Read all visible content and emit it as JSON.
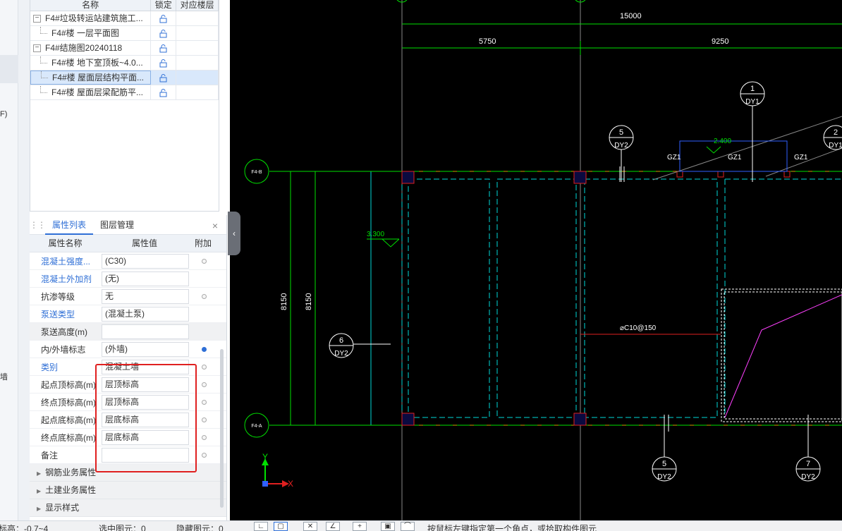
{
  "left_strip": {
    "frag1": "F)",
    "frag2": "墙"
  },
  "layer_tree": {
    "columns": {
      "name": "名称",
      "lock": "锁定",
      "floor": "对应楼层"
    },
    "rows": [
      {
        "label": "F4#垃圾转运站建筑施工...",
        "level": 0,
        "toggle": "−"
      },
      {
        "label": "F4#楼 一层平面图",
        "level": 1
      },
      {
        "label": "F4#结施图20240118",
        "level": 0,
        "toggle": "−"
      },
      {
        "label": "F4#楼 地下室顶板~4.0...",
        "level": 1
      },
      {
        "label": "F4#楼 屋面层结构平面...",
        "level": 1,
        "selected": true
      },
      {
        "label": "F4#楼 屋面层梁配筋平...",
        "level": 1
      }
    ]
  },
  "props": {
    "tabs": [
      "属性列表",
      "图层管理"
    ],
    "close": "×",
    "headers": {
      "name": "属性名称",
      "value": "属性值",
      "add": "附加"
    },
    "rows": [
      {
        "name": "混凝土强度...",
        "value": "(C30)",
        "blue": true,
        "dot": "off"
      },
      {
        "name": "混凝土外加剂",
        "value": "(无)",
        "blue": true,
        "dot": "none"
      },
      {
        "name": "抗渗等级",
        "value": "无",
        "blue": false,
        "dot": "off"
      },
      {
        "name": "泵送类型",
        "value": "(混凝土泵)",
        "blue": true,
        "dot": "none"
      },
      {
        "name": "泵送高度(m)",
        "value": "",
        "blue": false,
        "dot": "none",
        "gray": true
      },
      {
        "name": "内/外墙标志",
        "value": "(外墙)",
        "blue": false,
        "dot": "on"
      },
      {
        "name": "类别",
        "value": "混凝土墙",
        "blue": true,
        "dot": "off"
      },
      {
        "name": "起点顶标高(m)",
        "value": "层顶标高",
        "blue": false,
        "dot": "off"
      },
      {
        "name": "终点顶标高(m)",
        "value": "层顶标高",
        "blue": false,
        "dot": "off"
      },
      {
        "name": "起点底标高(m)",
        "value": "层底标高",
        "blue": false,
        "dot": "off"
      },
      {
        "name": "终点底标高(m)",
        "value": "层底标高",
        "blue": false,
        "dot": "off"
      },
      {
        "name": "备注",
        "value": "",
        "blue": false,
        "dot": "off"
      }
    ],
    "groups": [
      "钢筋业务属性",
      "土建业务属性",
      "显示样式"
    ]
  },
  "cad": {
    "dims": {
      "total": "15000",
      "left": "5750",
      "right": "9250",
      "v1": "8150",
      "v2": "8150"
    },
    "grid_labels": {
      "b": "F4-B",
      "a": "F4-A"
    },
    "elevations": {
      "e1": "3.300",
      "e2": "2.400"
    },
    "gz": [
      "GZ1",
      "GZ1",
      "GZ1"
    ],
    "rebar": "⌀C10@150",
    "details": [
      {
        "num": "1",
        "ref": "DY1"
      },
      {
        "num": "5",
        "ref": "DY2"
      },
      {
        "num": "2",
        "ref": "DY1"
      },
      {
        "num": "6",
        "ref": "DY2"
      },
      {
        "num": "5",
        "ref": "DY2"
      },
      {
        "num": "7",
        "ref": "DY2"
      }
    ],
    "axis": {
      "x": "X",
      "y": "Y"
    },
    "colors": {
      "cyan": "#00d8d8",
      "green": "#00e000",
      "red": "#e02020",
      "magenta": "#ff40ff",
      "blue": "#3060ff"
    }
  },
  "status": {
    "elevation": "标高：-0.7~4",
    "selected": "选中图元：0",
    "hidden": "隐藏图元：0",
    "hint": "按鼠标左键指定第一个角点，或拾取构件图元"
  }
}
